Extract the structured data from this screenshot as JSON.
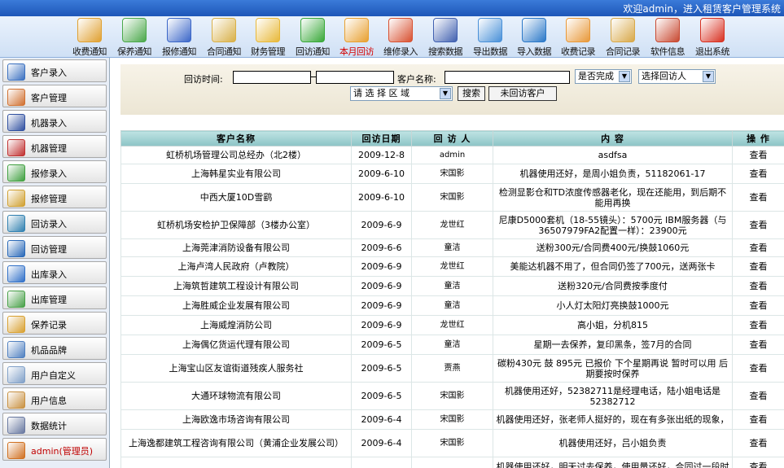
{
  "header": {
    "welcome": "欢迎admin，进入租赁客户管理系统"
  },
  "toolbar": {
    "items": [
      {
        "label": "收费通知",
        "icon": "money-receipt-icon",
        "color": "#e0a030"
      },
      {
        "label": "保养通知",
        "icon": "maintenance-icon",
        "color": "#4aa84a"
      },
      {
        "label": "报修通知",
        "icon": "repair-tools-icon",
        "color": "#3a66c8"
      },
      {
        "label": "合同通知",
        "icon": "contract-icon",
        "color": "#d8b048"
      },
      {
        "label": "财务管理",
        "icon": "finance-folder-icon",
        "color": "#e8b838"
      },
      {
        "label": "回访通知",
        "icon": "upload-arrow-icon",
        "color": "#38a838"
      },
      {
        "label": "本月回访",
        "icon": "mail-envelope-icon",
        "color": "#e8a030"
      },
      {
        "label": "维修录入",
        "icon": "schedule-icon",
        "color": "#d85030"
      },
      {
        "label": "搜索数据",
        "icon": "search-data-icon",
        "color": "#4060b0"
      },
      {
        "label": "导出数据",
        "icon": "export-user-icon",
        "color": "#4890d8"
      },
      {
        "label": "导入数据",
        "icon": "import-globe-icon",
        "color": "#2a78c8"
      },
      {
        "label": "收费记录",
        "icon": "fee-record-icon",
        "color": "#e89838"
      },
      {
        "label": "合同记录",
        "icon": "contract-record-icon",
        "color": "#d8a848"
      },
      {
        "label": "软件信息",
        "icon": "home-info-icon",
        "color": "#c84830"
      },
      {
        "label": "退出系统",
        "icon": "exit-icon",
        "color": "#d83020"
      }
    ]
  },
  "sidebar": {
    "items": [
      {
        "label": "客户录入",
        "icon": "customer-add-icon",
        "color": "#3a70c0"
      },
      {
        "label": "客户管理",
        "icon": "customer-manage-icon",
        "color": "#d07030"
      },
      {
        "label": "机器录入",
        "icon": "machine-add-icon",
        "color": "#3050a0"
      },
      {
        "label": "机器管理",
        "icon": "machine-manage-icon",
        "color": "#c03030"
      },
      {
        "label": "报修录入",
        "icon": "repair-add-icon",
        "color": "#40a040"
      },
      {
        "label": "报修管理",
        "icon": "repair-manage-icon",
        "color": "#d0a030"
      },
      {
        "label": "回访录入",
        "icon": "visit-add-icon",
        "color": "#3080b0"
      },
      {
        "label": "回访管理",
        "icon": "visit-manage-icon",
        "color": "#2868b8"
      },
      {
        "label": "出库录入",
        "icon": "outbound-add-icon",
        "color": "#3070c8"
      },
      {
        "label": "出库管理",
        "icon": "outbound-manage-icon",
        "color": "#48a048"
      },
      {
        "label": "保养记录",
        "icon": "maintenance-record-icon",
        "color": "#d8a030"
      },
      {
        "label": "机品品牌",
        "icon": "brand-icon",
        "color": "#5080c0"
      },
      {
        "label": "用户自定义",
        "icon": "user-custom-icon",
        "color": "#80a0c8"
      },
      {
        "label": "用户信息",
        "icon": "user-info-icon",
        "color": "#c89040"
      },
      {
        "label": "数据统计",
        "icon": "statistics-icon",
        "color": "#6878a0"
      },
      {
        "label": "admin(管理员)",
        "icon": "admin-building-icon",
        "color": "#d07020"
      }
    ]
  },
  "filter": {
    "visit_time_label": "回访时间:",
    "date_from": "",
    "date_to": "",
    "customer_label": "客户名称:",
    "customer_value": "",
    "completed_select": "是否完成",
    "visitor_select": "选择回访人",
    "region_select": "请 选 择 区 域",
    "search_button": "搜索",
    "not_visited_button": "未回访客户"
  },
  "table": {
    "columns": [
      "客户名称",
      "回访日期",
      "回 访 人",
      "内 容",
      "操 作"
    ],
    "rows": [
      [
        "虹桥机场管理公司总经办（北2楼）",
        "2009-12-8",
        "admin",
        "asdfsa",
        "查看"
      ],
      [
        "上海韩星实业有限公司",
        "2009-6-10",
        "宋国影",
        "机器使用还好，是周小姐负责，51182061-17",
        "查看"
      ],
      [
        "中西大厦10D雪鹞",
        "2009-6-10",
        "宋国影",
        "检测显影仓和TD浓度传感器老化，现在还能用，到后期不能用再换",
        "查看"
      ],
      [
        "虹桥机场安检护卫保障部（3楼办公室）",
        "2009-6-9",
        "龙世红",
        "尼康D5000套机（18-55镜头）：5700元 IBM服务器（与36507979FA2配置一样）：23900元",
        "查看"
      ],
      [
        "上海莞津消防设备有限公司",
        "2009-6-6",
        "童洁",
        "送粉300元/合同费400元/换鼓1060元",
        "查看"
      ],
      [
        "上海卢湾人民政府（卢教院）",
        "2009-6-9",
        "龙世红",
        "美能达机器不用了，但合同仍签了700元，送两张卡",
        "查看"
      ],
      [
        "上海筑哲建筑工程设计有限公司",
        "2009-6-9",
        "童洁",
        "送粉320元/合同费按季度付",
        "查看"
      ],
      [
        "上海胜威企业发展有限公司",
        "2009-6-9",
        "童洁",
        "小人灯太阳灯亮换鼓1000元",
        "查看"
      ],
      [
        "上海威煌消防公司",
        "2009-6-9",
        "龙世红",
        "高小姐，分机815",
        "查看"
      ],
      [
        "上海偶亿货运代理有限公司",
        "2009-6-5",
        "童洁",
        "星期一去保养，复印黑条，签7月的合同",
        "查看"
      ],
      [
        "上海宝山区友谊街道残疾人服务社",
        "2009-6-5",
        "贾燕",
        "碳粉430元 鼓 895元 已报价 下个星期再说 暂时可以用 后期要按时保养",
        "查看"
      ],
      [
        "大通环球物流有限公司",
        "2009-6-5",
        "宋国影",
        "机器使用还好，52382711是经理电话，陆小姐电话是52382712",
        "查看"
      ],
      [
        "上海欧逸市场咨询有限公司",
        "2009-6-4",
        "宋国影",
        "机器使用还好，张老师人挺好的，现在有多张出纸的现象，",
        "查看"
      ],
      [
        "上海逸都建筑工程咨询有限公司（黄浦企业发展公司）",
        "2009-6-4",
        "宋国影",
        "机器使用还好，吕小姐负责",
        "查看"
      ],
      [
        "",
        "",
        "",
        "机器使用还好，明天过去保养，使用量还好，合同过一段时",
        "查看"
      ]
    ]
  }
}
